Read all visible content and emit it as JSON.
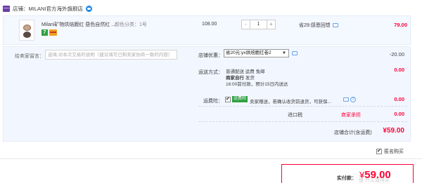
{
  "shop": {
    "icon": "shop-icon",
    "name": "店铺：MILANI官方海外旗舰店",
    "chat_icon": "wangwang-icon"
  },
  "item": {
    "title": "Milani矿物烘焙腮红 昼色自然红 ...",
    "spec": "颜色分类：1号",
    "badge_7": "7",
    "unit_price": "108.00",
    "qty_minus": "-",
    "quantity": "1",
    "qty_plus": "+",
    "discount": "省29:感恩回馈",
    "subtotal": "79.00"
  },
  "message": {
    "label": "给卖家留言：",
    "placeholder": "选填:对本次交易的说明（建议填写已和卖家协商一致的内容）"
  },
  "coupon": {
    "label": "店铺优惠：",
    "selected": "省20元:yx烘焙腮红卷2",
    "value": "-20.00"
  },
  "shipping": {
    "label": "运送方式：",
    "line1": "普通配送 运费 免邮",
    "line2_bold": "商家自行",
    "line2_rest": "发货",
    "line3": "16:00前付款，预计15日内送达",
    "value": "0.00"
  },
  "insurance": {
    "label": "运费险：",
    "tag": "运费险",
    "text": "卖家赠送，若确认收货前退货，可获保...",
    "question": "?",
    "value": "0.00"
  },
  "import_tax": {
    "label": "进口税",
    "status": "商家承担",
    "value": "0.00"
  },
  "total": {
    "label": "店铺合计(含运费)",
    "value": "¥59.00"
  },
  "anonymous": {
    "label": "匿名购买"
  },
  "payment": {
    "label": "实付款：",
    "symbol": "¥",
    "amount": "59.00"
  },
  "watermark": "值 什么值得买"
}
